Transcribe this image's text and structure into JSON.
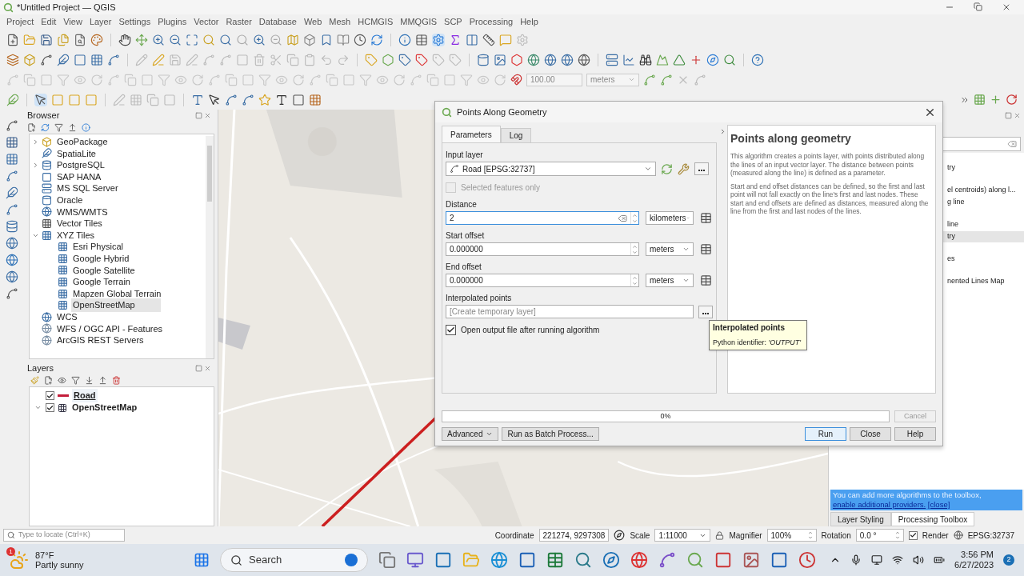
{
  "window": {
    "title": "*Untitled Project — QGIS"
  },
  "menu": [
    "Project",
    "Edit",
    "View",
    "Layer",
    "Settings",
    "Plugins",
    "Vector",
    "Raster",
    "Database",
    "Web",
    "Mesh",
    "HCMGIS",
    "MMQGIS",
    "SCP",
    "Processing",
    "Help"
  ],
  "snapping": {
    "tolerance": "100.00",
    "unit": "meters"
  },
  "browser": {
    "title": "Browser",
    "items": [
      {
        "label": "GeoPackage",
        "kind": "geopackage",
        "expanded": false,
        "selected": false
      },
      {
        "label": "SpatiaLite",
        "kind": "spatialite",
        "selected": false
      },
      {
        "label": "PostgreSQL",
        "kind": "postgres",
        "expanded": false,
        "selected": false
      },
      {
        "label": "SAP HANA",
        "kind": "hana",
        "selected": false
      },
      {
        "label": "MS SQL Server",
        "kind": "mssql",
        "selected": false
      },
      {
        "label": "Oracle",
        "kind": "oracle",
        "selected": false
      },
      {
        "label": "WMS/WMTS",
        "kind": "wms",
        "selected": false
      },
      {
        "label": "Vector Tiles",
        "kind": "vectortiles",
        "selected": false
      },
      {
        "label": "XYZ Tiles",
        "kind": "xyz",
        "expanded": true,
        "selected": false,
        "children": [
          {
            "label": "Esri Physical",
            "kind": "xyz",
            "selected": false
          },
          {
            "label": "Google Hybrid",
            "kind": "xyz",
            "selected": false
          },
          {
            "label": "Google Satellite",
            "kind": "xyz",
            "selected": false
          },
          {
            "label": "Google Terrain",
            "kind": "xyz",
            "selected": false
          },
          {
            "label": "Mapzen Global Terrain",
            "kind": "xyz",
            "selected": false
          },
          {
            "label": "OpenStreetMap",
            "kind": "xyz",
            "selected": true
          }
        ]
      },
      {
        "label": "WCS",
        "kind": "wms",
        "selected": false
      },
      {
        "label": "WFS / OGC API - Features",
        "kind": "wfs",
        "selected": false
      },
      {
        "label": "ArcGIS REST Servers",
        "kind": "wfs",
        "selected": false
      }
    ]
  },
  "layers": {
    "title": "Layers",
    "items": [
      {
        "name": "Road",
        "kind": "line",
        "checked": true,
        "selected": true
      },
      {
        "name": "OpenStreetMap",
        "kind": "raster",
        "checked": true,
        "selected": false,
        "expanded": true
      }
    ]
  },
  "processing_toolbox": {
    "items": [
      {
        "label": "try",
        "selected": false
      },
      {
        "label": "el centroids) along l...",
        "selected": false
      },
      {
        "label": "g line",
        "selected": false
      },
      {
        "label": "line",
        "selected": false
      },
      {
        "label": "try",
        "selected": true
      },
      {
        "label": "es",
        "selected": false
      },
      {
        "label": "nented Lines Map",
        "selected": false
      }
    ],
    "info": "You can add more algorithms to the toolbox, ",
    "info_link": "enable additional providers.",
    "close_link": "[close]"
  },
  "dock_tabs": [
    {
      "label": "Layer Styling",
      "selected": false
    },
    {
      "label": "Processing Toolbox",
      "selected": true
    }
  ],
  "dialog": {
    "title": "Points Along Geometry",
    "tabs": [
      {
        "label": "Parameters",
        "selected": true
      },
      {
        "label": "Log",
        "selected": false
      }
    ],
    "params": [
      {
        "kind": "layer",
        "label": "Input layer",
        "value": "Road [EPSG:32737]"
      },
      {
        "kind": "checkbox",
        "label": "Selected features only",
        "checked": false,
        "disabled": true
      },
      {
        "kind": "distance",
        "label": "Distance",
        "value": "2",
        "unit": "kilometers",
        "focused": true
      },
      {
        "kind": "distance",
        "label": "Start offset",
        "value": "0.000000",
        "unit": "meters",
        "focused": false
      },
      {
        "kind": "distance",
        "label": "End offset",
        "value": "0.000000",
        "unit": "meters",
        "focused": false
      },
      {
        "kind": "output",
        "label": "Interpolated points",
        "placeholder": "[Create temporary layer]"
      },
      {
        "kind": "checkbox",
        "label": "Open output file after running algorithm",
        "checked": true,
        "disabled": false
      }
    ],
    "help": {
      "title": "Points along geometry",
      "paragraphs": [
        "This algorithm creates a points layer, with points distributed along the lines of an input vector layer. The distance between points (measured along the line) is defined as a parameter.",
        "Start and end offset distances can be defined, so the first and last point will not fall exactly on the line's first and last nodes. These start and end offsets are defined as distances, measured along the line from the first and last nodes of the lines."
      ]
    },
    "progress": {
      "level": 0,
      "label": "0%"
    },
    "cancel": {
      "label": "Cancel",
      "disabled": true
    },
    "buttons_left": [
      {
        "label": "Advanced",
        "kind": "menu"
      },
      {
        "label": "Run as Batch Process...",
        "kind": "plain"
      }
    ],
    "buttons_right": [
      {
        "label": "Run",
        "kind": "default"
      },
      {
        "label": "Close",
        "kind": "plain"
      },
      {
        "label": "Help",
        "kind": "plain"
      }
    ],
    "tooltip": {
      "title": "Interpolated points",
      "text": "Python identifier: *'OUTPUT'*"
    }
  },
  "status_bar": {
    "locate_placeholder": "Type to locate (Ctrl+K)",
    "coordinate_label": "Coordinate",
    "coordinate": "221274, 9297308",
    "scale_label": "Scale",
    "scale": "1:11000",
    "magnifier_label": "Magnifier",
    "magnifier": "100%",
    "rotation_label": "Rotation",
    "rotation": "0.0 °",
    "render_label": "Render",
    "render_checked": true,
    "crs": "EPSG:32737"
  },
  "taskbar": {
    "weather_badge": "1",
    "temperature": "87°F",
    "condition": "Partly sunny",
    "search": "Search",
    "time": "3:56 PM",
    "date": "6/27/2023",
    "notifications": "2"
  }
}
